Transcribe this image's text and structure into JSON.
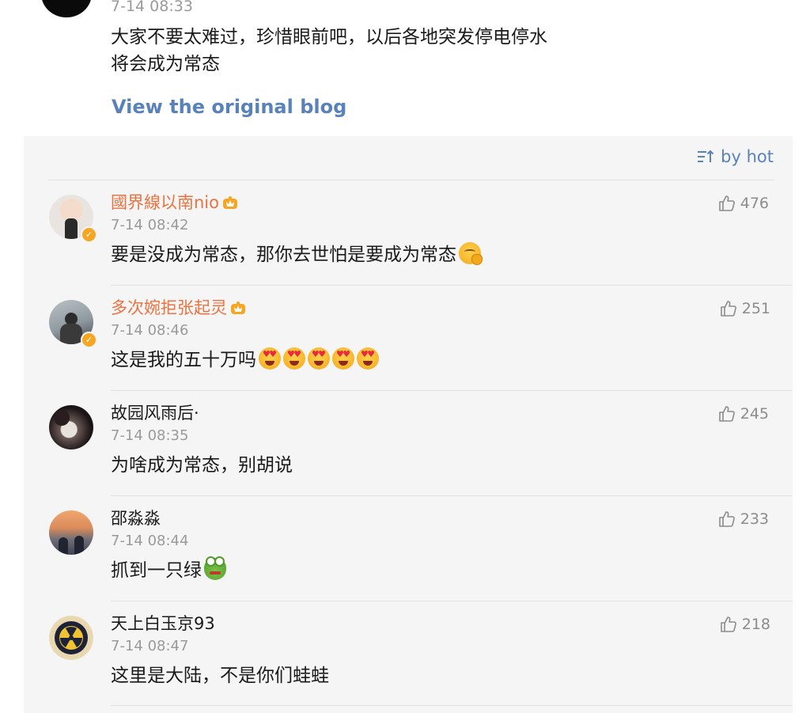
{
  "post": {
    "time": "7-14 08:33",
    "text": "大家不要太难过，珍惜眼前吧，以后各地突发停电停水\n将会成为常态",
    "view_link": "View the original blog"
  },
  "sort": {
    "label": "by hot",
    "icon": "sort-icon"
  },
  "colors": {
    "vip_name": "#eb7340",
    "link": "#5a82ba",
    "verified": "#f6a623",
    "panel_bg": "#f5f5f5"
  },
  "comments": [
    {
      "name": "國界線以南nio",
      "vip": true,
      "verified": true,
      "time": "7-14 08:42",
      "text": "要是没成为常态，那你去世怕是要成为常态",
      "emoji": "thinking-face-icon",
      "likes": "476"
    },
    {
      "name": "多次婉拒张起灵",
      "vip": true,
      "verified": true,
      "time": "7-14 08:46",
      "text": "这是我的五十万吗",
      "emoji": "heart-eyes-icon x5",
      "likes": "251"
    },
    {
      "name": "故园风雨后·",
      "vip": false,
      "verified": false,
      "time": "7-14 08:35",
      "text": "为啥成为常态，别胡说",
      "likes": "245"
    },
    {
      "name": "邵淼淼",
      "vip": false,
      "verified": false,
      "time": "7-14 08:44",
      "text": "抓到一只绿",
      "emoji": "frog-icon",
      "likes": "233"
    },
    {
      "name": "天上白玉京93",
      "vip": false,
      "verified": false,
      "time": "7-14 08:47",
      "text": "这里是大陆，不是你们蛙蛙",
      "likes": "218"
    }
  ]
}
